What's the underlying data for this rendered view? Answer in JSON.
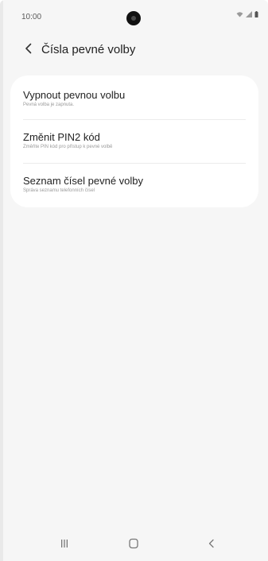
{
  "status_bar": {
    "time": "10:00",
    "icons": [
      "wifi-icon",
      "signal-icon",
      "battery-icon"
    ]
  },
  "app_bar": {
    "back_icon": "chevron-left-icon",
    "title": "Čísla pevné volby"
  },
  "settings": {
    "items": [
      {
        "title": "Vypnout pevnou volbu",
        "subtitle": "Pevná volba je zapnuta."
      },
      {
        "title": "Změnit PIN2 kód",
        "subtitle": "Změňte PIN kód pro přístup k pevné volbě"
      },
      {
        "title": "Seznam čísel pevné volby",
        "subtitle": "Správa seznamu telefonních čísel"
      }
    ]
  },
  "nav_bar": {
    "recents_icon": "recents-icon",
    "home_icon": "home-icon",
    "back_icon": "back-icon"
  },
  "colors": {
    "background": "#f6f6f6",
    "card": "#ffffff",
    "text_primary": "#222222",
    "text_secondary": "#9a9a9a"
  }
}
